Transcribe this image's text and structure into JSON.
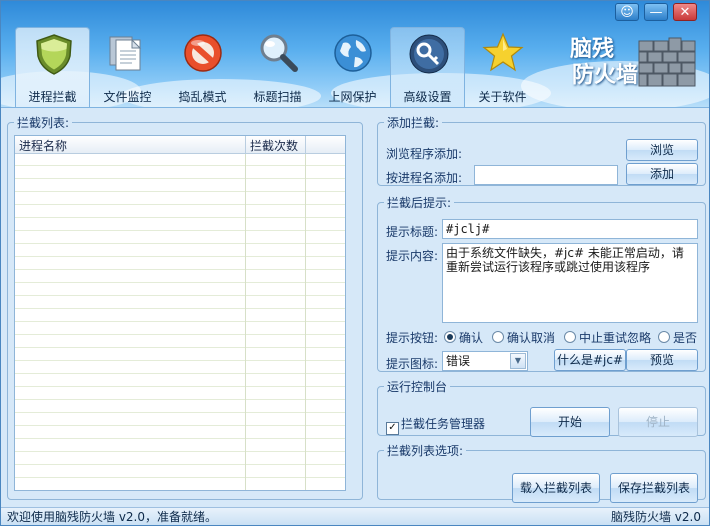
{
  "toolbar": {
    "items": [
      {
        "label": "进程拦截",
        "icon": "shield-icon"
      },
      {
        "label": "文件监控",
        "icon": "documents-icon"
      },
      {
        "label": "捣乱模式",
        "icon": "forbidden-icon"
      },
      {
        "label": "标题扫描",
        "icon": "magnifier-icon"
      },
      {
        "label": "上网保护",
        "icon": "globe-icon"
      },
      {
        "label": "高级设置",
        "icon": "key-icon"
      },
      {
        "label": "关于软件",
        "icon": "star-icon"
      }
    ],
    "active_index": 0
  },
  "brand": {
    "line1": "脑残",
    "line2": "防火墙",
    "icon": "brick-wall-icon"
  },
  "window_controls": {
    "skin": "☺",
    "minimize": "—",
    "close": "✕"
  },
  "intercept_list": {
    "legend": "拦截列表:",
    "columns": [
      "进程名称",
      "拦截次数"
    ],
    "rows": []
  },
  "add_intercept": {
    "legend": "添加拦截:",
    "browse_label": "浏览程序添加:",
    "browse_button": "浏览",
    "name_label": "按进程名添加:",
    "name_value": "",
    "add_button": "添加"
  },
  "after_prompt": {
    "legend": "拦截后提示:",
    "title_label": "提示标题:",
    "title_value": "#jclj#",
    "content_label": "提示内容:",
    "content_value": "由于系统文件缺失，#jc# 未能正常启动，请重新尝试运行该程序或跳过使用该程序",
    "buttons_label": "提示按钮:",
    "button_options": [
      "确认",
      "确认取消",
      "中止重试忽略",
      "是否"
    ],
    "button_selected": 0,
    "icon_label": "提示图标:",
    "icon_value": "错误",
    "what_button": "什么是#jc#",
    "preview_button": "预览"
  },
  "console": {
    "legend": "运行控制台",
    "taskmgr_label": "拦截任务管理器",
    "taskmgr_checked": true,
    "start_button": "开始",
    "stop_button": "停止"
  },
  "list_options": {
    "legend": "拦截列表选项:",
    "load_button": "载入拦截列表",
    "save_button": "保存拦截列表"
  },
  "status": {
    "left": "欢迎使用脑残防火墙 v2.0，准备就绪。",
    "right": "脑残防火墙 v2.0"
  },
  "colors": {
    "accent": "#2f8ad9",
    "panel": "#d6e8f8",
    "border": "#8fb5d8"
  }
}
